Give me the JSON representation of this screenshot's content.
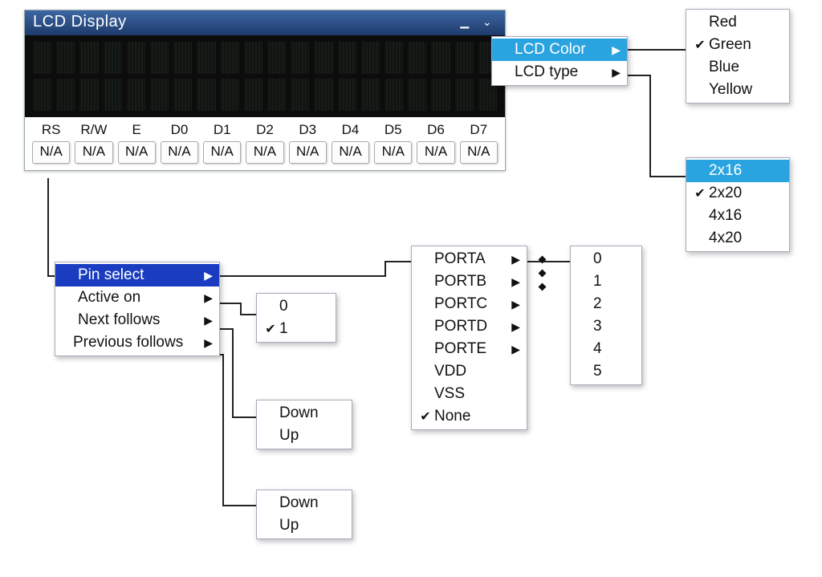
{
  "lcd": {
    "title": "LCD Display",
    "pins": [
      "RS",
      "R/W",
      "E",
      "D0",
      "D1",
      "D2",
      "D3",
      "D4",
      "D5",
      "D6",
      "D7"
    ],
    "pin_values": [
      "N/A",
      "N/A",
      "N/A",
      "N/A",
      "N/A",
      "N/A",
      "N/A",
      "N/A",
      "N/A",
      "N/A",
      "N/A"
    ]
  },
  "lcd_menu": {
    "items": [
      {
        "label": "LCD Color",
        "has_sub": true,
        "highlight": true
      },
      {
        "label": "LCD type",
        "has_sub": true
      }
    ]
  },
  "color_menu": {
    "items": [
      {
        "label": "Red"
      },
      {
        "label": "Green",
        "checked": true
      },
      {
        "label": "Blue"
      },
      {
        "label": "Yellow"
      }
    ]
  },
  "type_menu": {
    "items": [
      {
        "label": "2x16",
        "highlight": true
      },
      {
        "label": "2x20",
        "checked": true
      },
      {
        "label": "4x16"
      },
      {
        "label": "4x20"
      }
    ]
  },
  "pin_menu": {
    "items": [
      {
        "label": "Pin select",
        "has_sub": true,
        "highlight": true
      },
      {
        "label": "Active on",
        "has_sub": true
      },
      {
        "label": "Next follows",
        "has_sub": true
      },
      {
        "label": "Previous follows",
        "has_sub": true
      }
    ]
  },
  "active_on_menu": {
    "items": [
      {
        "label": "0"
      },
      {
        "label": "1",
        "checked": true
      }
    ]
  },
  "next_menu": {
    "items": [
      {
        "label": "Down"
      },
      {
        "label": "Up"
      }
    ]
  },
  "prev_menu": {
    "items": [
      {
        "label": "Down"
      },
      {
        "label": "Up"
      }
    ]
  },
  "port_menu": {
    "items": [
      {
        "label": "PORTA",
        "has_sub": true
      },
      {
        "label": "PORTB",
        "has_sub": true
      },
      {
        "label": "PORTC",
        "has_sub": true
      },
      {
        "label": "PORTD",
        "has_sub": true
      },
      {
        "label": "PORTE",
        "has_sub": true
      },
      {
        "label": "VDD"
      },
      {
        "label": "VSS"
      },
      {
        "label": "None",
        "checked": true
      }
    ]
  },
  "bit_menu": {
    "items": [
      {
        "label": "0"
      },
      {
        "label": "1"
      },
      {
        "label": "2"
      },
      {
        "label": "3"
      },
      {
        "label": "4"
      },
      {
        "label": "5"
      }
    ]
  }
}
